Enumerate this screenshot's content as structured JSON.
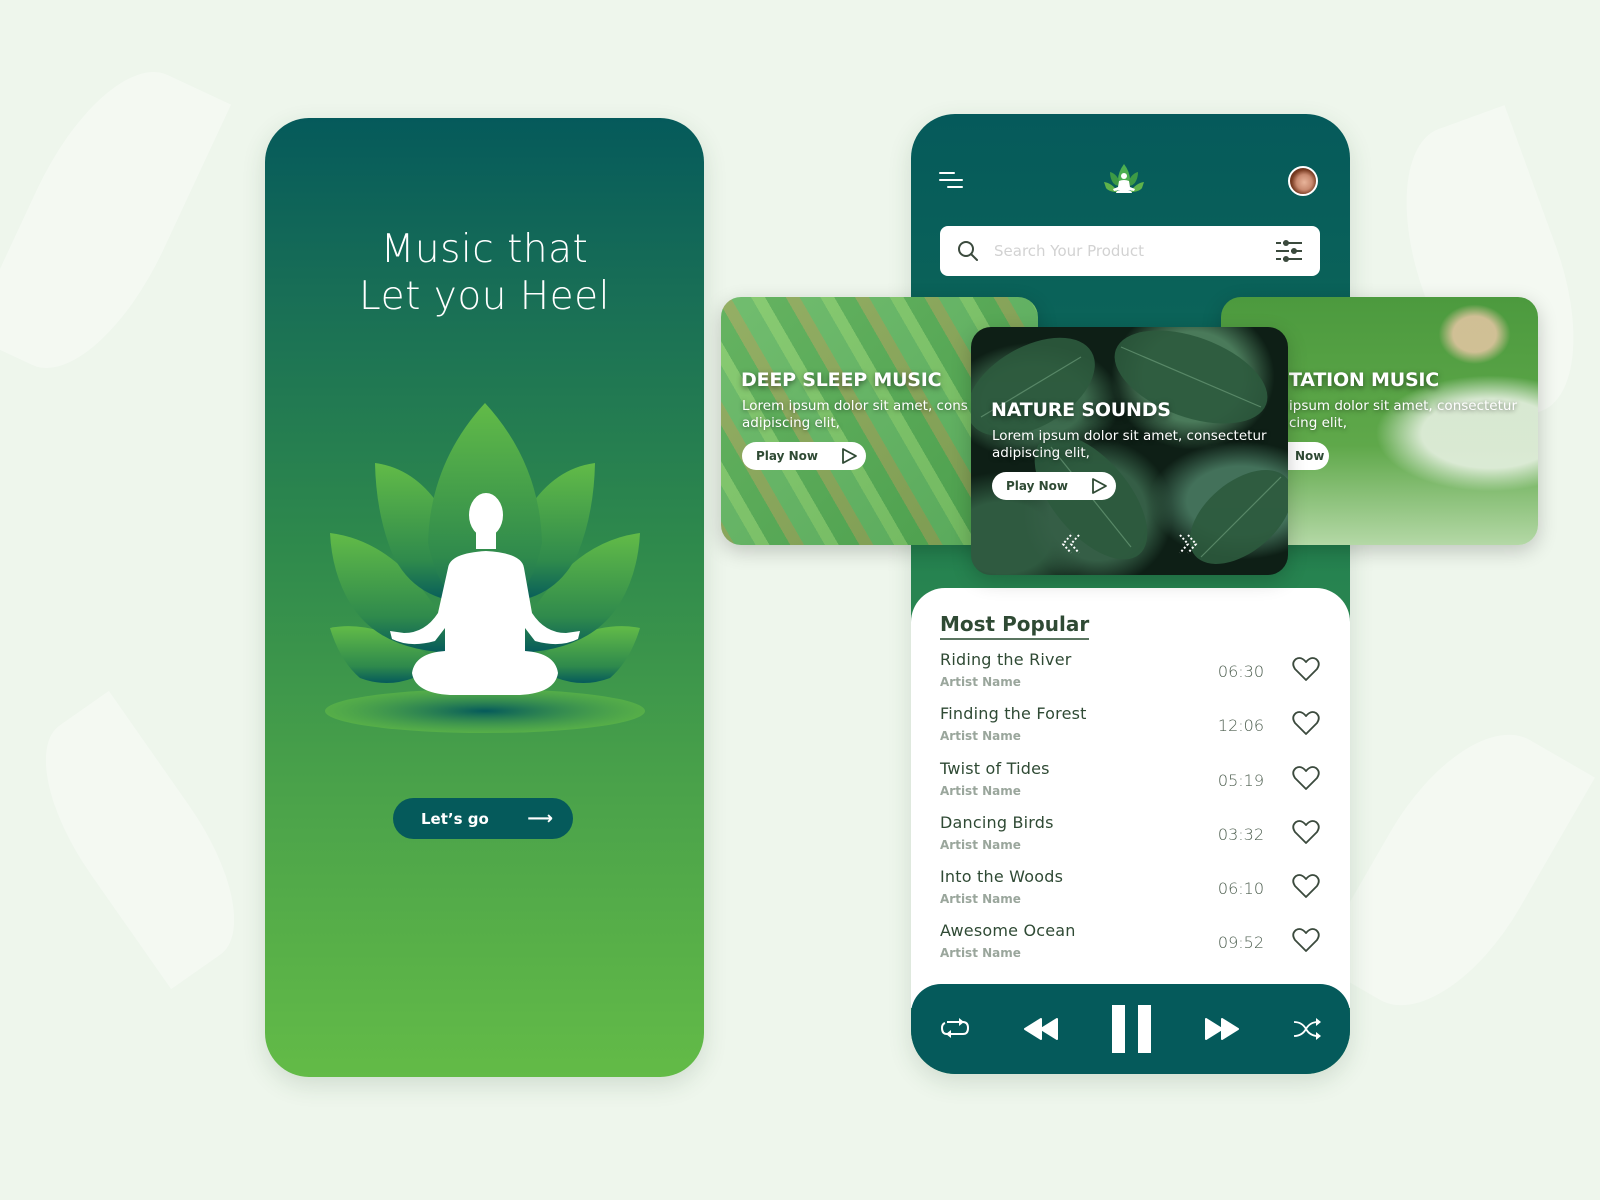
{
  "colors": {
    "brand_dark": "#055a5b",
    "brand_light": "#63bb47",
    "text_dark": "#2f4a34",
    "text_muted": "#9aa69c",
    "background": "#eef6ec"
  },
  "welcome_screen": {
    "title_line1": "Music that",
    "title_line2": "Let you Heel",
    "illustration": "lotus-meditation-illustration",
    "cta_label": "Let’s go",
    "cta_icon": "arrow-right-icon"
  },
  "home_screen": {
    "header": {
      "menu_icon": "hamburger-menu-icon",
      "logo_icon": "lotus-meditation-logo",
      "avatar": "user-avatar"
    },
    "search": {
      "placeholder": "Search Your Product",
      "value": "",
      "search_icon": "search-icon",
      "filter_icon": "filter-sliders-icon"
    },
    "carousel": {
      "cards": [
        {
          "title": "DEEP SLEEP MUSIC",
          "description_line1": "Lorem ipsum dolor sit amet, cons",
          "description_line2": "adipiscing elit,",
          "button_label": "Play Now",
          "position": "left"
        },
        {
          "title": "NATURE SOUNDS",
          "description_line1": "Lorem ipsum dolor sit amet, consectetur",
          "description_line2": "adipiscing elit,",
          "button_label": "Play Now",
          "position": "center"
        },
        {
          "title": "TATION MUSIC",
          "description_line1": "ipsum dolor sit amet, consectetur",
          "description_line2": "cing elit,",
          "button_label": "Now",
          "position": "right"
        }
      ],
      "prev_icon": "chevron-double-left-icon",
      "next_icon": "chevron-double-right-icon"
    },
    "most_popular": {
      "title": "Most Popular",
      "tracks": [
        {
          "title": "Riding the River",
          "artist": "Artist Name",
          "duration": "06:30"
        },
        {
          "title": "Finding the Forest",
          "artist": "Artist Name",
          "duration": "12:06"
        },
        {
          "title": "Twist of Tides",
          "artist": "Artist Name",
          "duration": "05:19"
        },
        {
          "title": "Dancing Birds",
          "artist": "Artist Name",
          "duration": "03:32"
        },
        {
          "title": "Into the Woods",
          "artist": "Artist Name",
          "duration": "06:10"
        },
        {
          "title": "Awesome Ocean",
          "artist": "Artist Name",
          "duration": "09:52"
        }
      ]
    },
    "player": {
      "controls": [
        "repeat-icon",
        "rewind-icon",
        "pause-icon",
        "fast-forward-icon",
        "shuffle-icon"
      ]
    }
  }
}
